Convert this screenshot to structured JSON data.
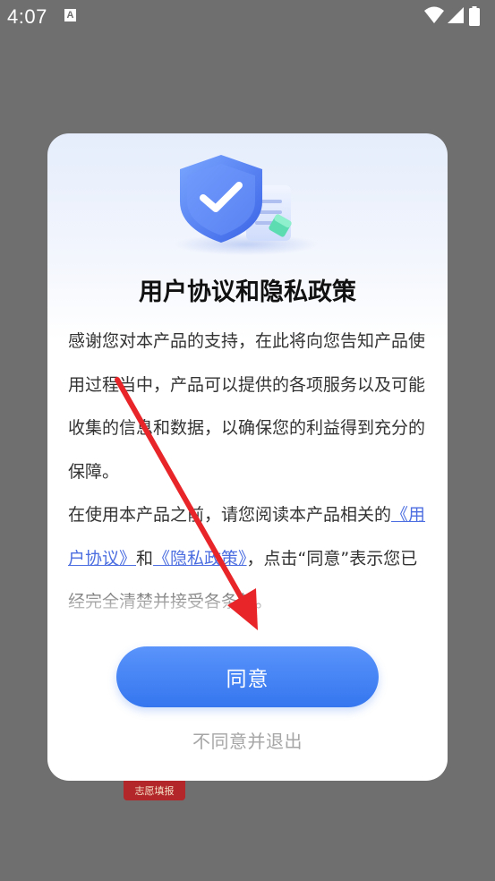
{
  "status_bar": {
    "time": "4:07",
    "notification_icon": "A"
  },
  "background": {
    "app_label": "志愿填报"
  },
  "dialog": {
    "title": "用户协议和隐私政策",
    "illustration": "shield-check-icon",
    "paragraph1": "感谢您对本产品的支持，在此将向您告知产品使用过程当中，产品可以提供的各项服务以及可能收集的信息和数据，以确保您的利益得到充分的保障。",
    "paragraph2_before": "在使用本产品之前，请您阅读本产品相关的",
    "user_agreement_link": "《用户协议》",
    "and_text": "和",
    "privacy_policy_link": "《隐私政策》",
    "paragraph2_after": "，点击“同意”表示您已经完全清楚并接受各条款。",
    "agree_label": "同意",
    "disagree_label": "不同意并退出"
  },
  "colors": {
    "accent": "#3a7bf2",
    "link": "#4c6ee0",
    "annotation_arrow": "#e8262a"
  }
}
